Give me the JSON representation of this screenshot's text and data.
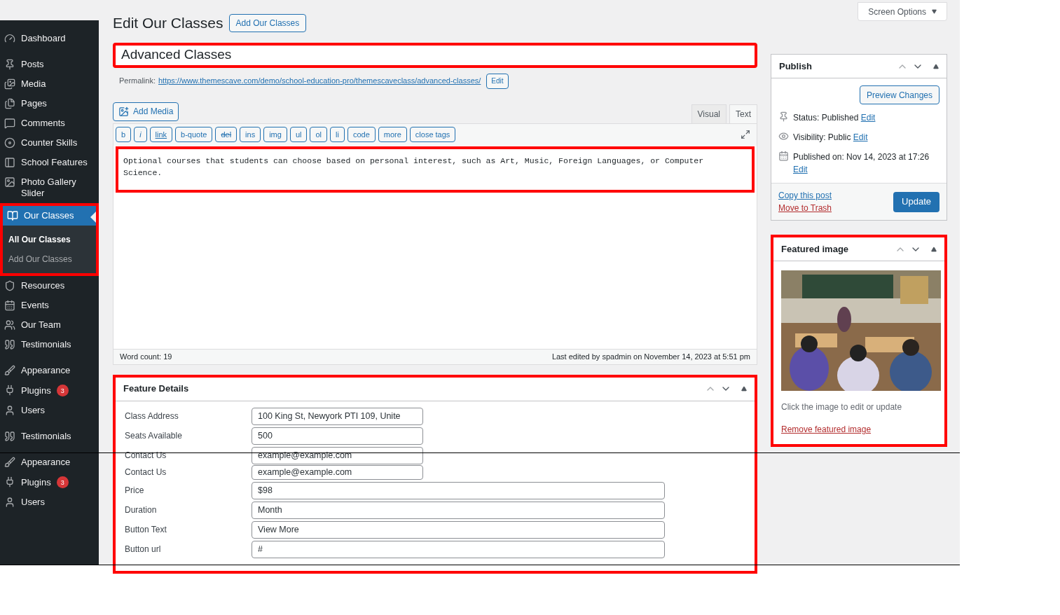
{
  "sidebar": {
    "items": [
      {
        "label": "Dashboard",
        "selected": false
      },
      {
        "label": "Posts",
        "selected": false
      },
      {
        "label": "Media",
        "selected": false
      },
      {
        "label": "Pages",
        "selected": false
      },
      {
        "label": "Comments",
        "selected": false
      },
      {
        "label": "Counter Skills",
        "selected": false
      },
      {
        "label": "School Features",
        "selected": false
      },
      {
        "label": "Photo Gallery Slider",
        "selected": false
      },
      {
        "label": "Our Classes",
        "selected": true,
        "highlighted": true,
        "children": [
          {
            "label": "All Our Classes",
            "selected": true
          },
          {
            "label": "Add Our Classes",
            "selected": false
          }
        ]
      },
      {
        "label": "Resources",
        "selected": false
      },
      {
        "label": "Events",
        "selected": false
      },
      {
        "label": "Our Team",
        "selected": false
      },
      {
        "label": "Testimonials",
        "selected": false
      },
      {
        "label": "Appearance",
        "selected": false
      },
      {
        "label": "Plugins",
        "selected": false,
        "badge": "3"
      },
      {
        "label": "Users",
        "selected": false
      },
      {
        "label": "Testimonials",
        "selected": false
      },
      {
        "label": "Appearance",
        "selected": false
      },
      {
        "label": "Plugins",
        "selected": false,
        "badge": "3"
      },
      {
        "label": "Users",
        "selected": false
      }
    ]
  },
  "screen_options": "Screen Options",
  "page_title": "Edit Our Classes",
  "add_button": "Add Our Classes",
  "title_field": {
    "value": "Advanced Classes",
    "highlighted": true
  },
  "permalink": {
    "label": "Permalink:",
    "url": "https://www.themescave.com/demo/school-education-pro/themescaveclass/advanced-classes/",
    "edit": "Edit"
  },
  "add_media": "Add Media",
  "editor_tabs": [
    {
      "label": "Visual",
      "selected": false
    },
    {
      "label": "Text",
      "selected": true
    }
  ],
  "quicktags": [
    "b",
    "i",
    "link",
    "b-quote",
    "del",
    "ins",
    "img",
    "ul",
    "ol",
    "li",
    "code",
    "more",
    "close tags"
  ],
  "content": {
    "value": "Optional courses that students can choose based on personal interest, such as Art, Music, Foreign Languages, or Computer Science.",
    "highlighted": true
  },
  "word_count": "Word count: 19",
  "last_edited": "Last edited by spadmin on November 14, 2023 at 5:51 pm",
  "feature_details": {
    "title": "Feature Details",
    "highlighted": true,
    "fields": [
      {
        "label": "Class Address",
        "value": "100 King St, Newyork PTI 109, Unite",
        "wide": false
      },
      {
        "label": "Seats Available",
        "value": "500",
        "wide": false
      },
      {
        "label": "Contact Us",
        "value": "example@example.com",
        "wide": false
      },
      {
        "label": "Contact Us",
        "value": "example@example.com",
        "wide": false
      },
      {
        "label": "Price",
        "value": "$98",
        "wide": true
      },
      {
        "label": "Duration",
        "value": "Month",
        "wide": true
      },
      {
        "label": "Button Text",
        "value": "View More",
        "wide": true
      },
      {
        "label": "Button url",
        "value": "#",
        "wide": true
      }
    ]
  },
  "publish": {
    "title": "Publish",
    "preview": "Preview Changes",
    "rows": [
      {
        "text": "Status: Published",
        "link": "Edit"
      },
      {
        "text": "Visibility: Public",
        "link": "Edit"
      },
      {
        "text": "Published on: Nov 14, 2023 at 17:26",
        "link": "Edit"
      }
    ],
    "copy": "Copy this post",
    "trash": "Move to Trash",
    "update": "Update"
  },
  "featured_image": {
    "title": "Featured image",
    "highlighted": true,
    "hint": "Click the image to edit or update",
    "remove": "Remove featured image"
  }
}
